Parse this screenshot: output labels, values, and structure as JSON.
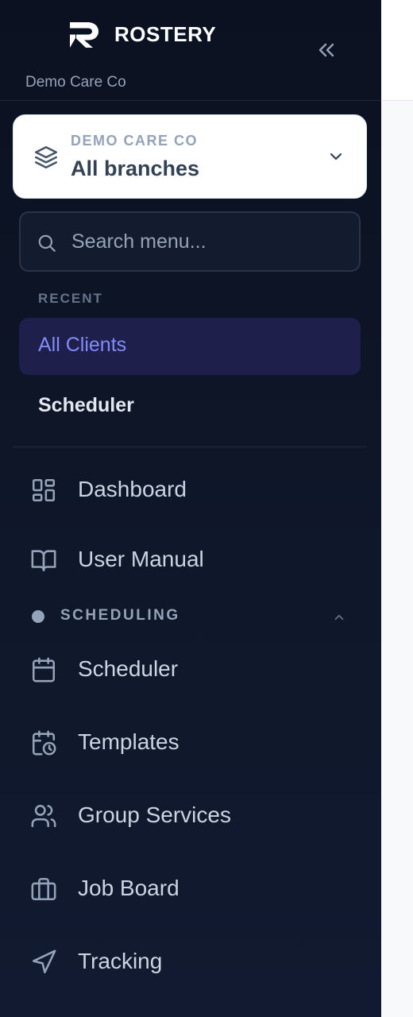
{
  "brand": {
    "name": "ROSTERY",
    "org_subtitle": "Demo Care Co"
  },
  "branch_selector": {
    "org": "DEMO CARE CO",
    "branch": "All branches"
  },
  "search": {
    "placeholder": "Search menu..."
  },
  "recent": {
    "label": "RECENT",
    "items": [
      {
        "label": "All Clients",
        "active": true
      },
      {
        "label": "Scheduler",
        "active": false
      }
    ]
  },
  "nav": {
    "items": [
      {
        "label": "Dashboard",
        "icon": "dashboard-icon"
      },
      {
        "label": "User Manual",
        "icon": "book-icon"
      }
    ]
  },
  "scheduling": {
    "label": "SCHEDULING",
    "expanded": true,
    "items": [
      {
        "label": "Scheduler",
        "icon": "calendar-icon"
      },
      {
        "label": "Templates",
        "icon": "calendar-clock-icon"
      },
      {
        "label": "Group Services",
        "icon": "users-icon"
      },
      {
        "label": "Job Board",
        "icon": "briefcase-icon"
      },
      {
        "label": "Tracking",
        "icon": "navigation-icon"
      }
    ]
  },
  "colors": {
    "sidebar_bg": "#0f172a",
    "accent": "#818cf8",
    "active_bg": "#1e1f4b",
    "text": "#cbd5e1",
    "muted": "#94a3b8"
  }
}
